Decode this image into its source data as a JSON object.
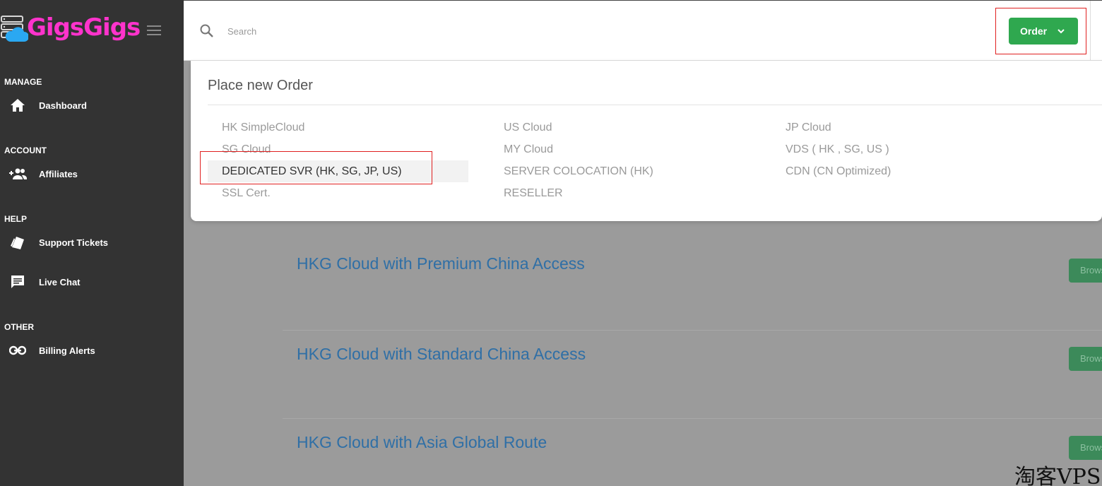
{
  "brand": {
    "name": "GigsGigs",
    "color": "#ff33cc"
  },
  "sidebar": {
    "sections": [
      {
        "title": "MANAGE",
        "items": [
          {
            "label": "Dashboard",
            "icon": "home-icon"
          }
        ]
      },
      {
        "title": "ACCOUNT",
        "items": [
          {
            "label": "Affiliates",
            "icon": "users-add-icon"
          }
        ]
      },
      {
        "title": "HELP",
        "items": [
          {
            "label": "Support Tickets",
            "icon": "tickets-icon"
          },
          {
            "label": "Live Chat",
            "icon": "chat-icon"
          }
        ]
      },
      {
        "title": "OTHER",
        "items": [
          {
            "label": "Billing Alerts",
            "icon": "link-icon"
          }
        ]
      }
    ]
  },
  "header": {
    "search": {
      "placeholder": "Search",
      "icon": "search-icon"
    },
    "order_button": {
      "label": "Order",
      "icon": "chevron-down-icon",
      "color": "#2fa84f"
    }
  },
  "dropdown": {
    "title": "Place new Order",
    "columns": [
      [
        "HK SimpleCloud",
        "SG Cloud",
        "DEDICATED SVR (HK, SG, JP, US)",
        "SSL Cert."
      ],
      [
        "US Cloud",
        "MY Cloud",
        "SERVER COLOCATION (HK)",
        "RESELLER"
      ],
      [
        "JP Cloud",
        "VDS ( HK , SG, US )",
        "CDN (CN Optimized)"
      ]
    ],
    "active_item": "DEDICATED SVR (HK, SG, JP, US)"
  },
  "products": [
    {
      "title": "HKG Cloud with Premium China Access",
      "button": "Browse"
    },
    {
      "title": "HKG Cloud with Standard China Access",
      "button": "Browse"
    },
    {
      "title": "HKG Cloud with Asia Global Route",
      "button": "Browse"
    }
  ],
  "watermark": "淘客VPS"
}
